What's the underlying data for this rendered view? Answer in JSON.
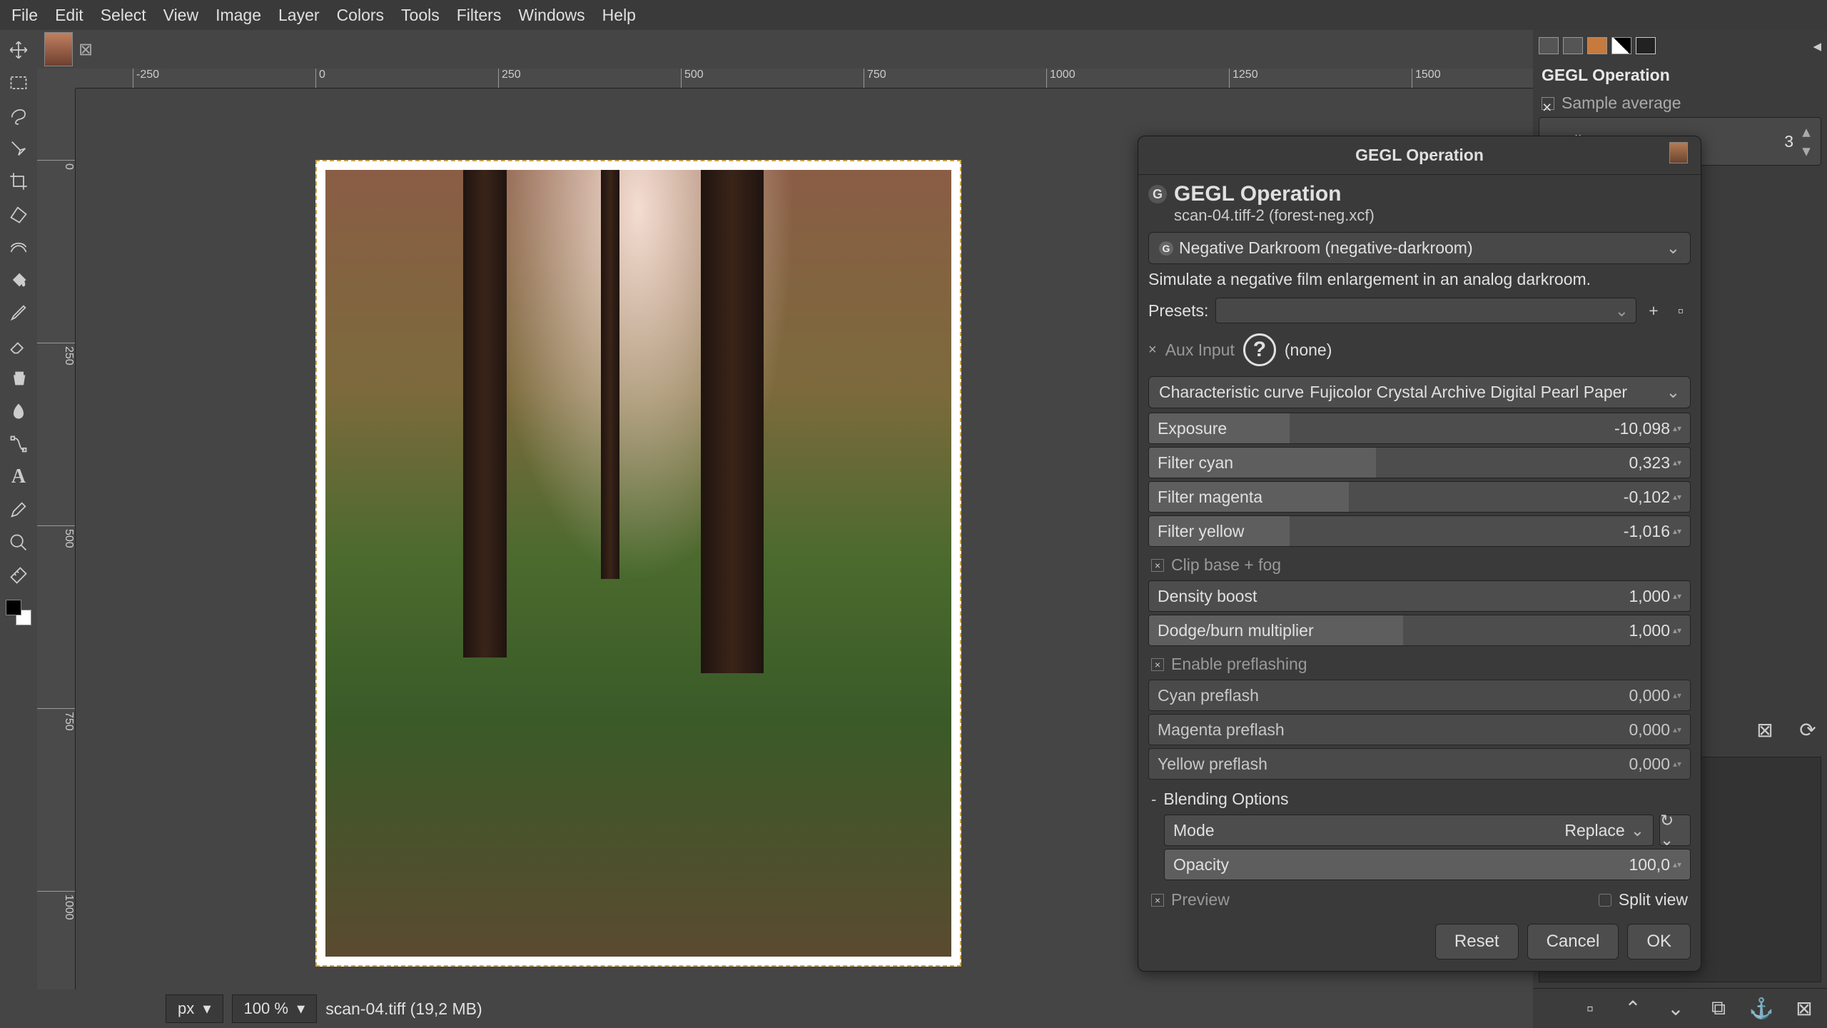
{
  "menu": {
    "items": [
      "File",
      "Edit",
      "Select",
      "View",
      "Image",
      "Layer",
      "Colors",
      "Tools",
      "Filters",
      "Windows",
      "Help"
    ]
  },
  "ruler_h": [
    "-250",
    "0",
    "250",
    "500",
    "750",
    "1000",
    "1250",
    "1500"
  ],
  "ruler_v": [
    "0",
    "250",
    "500",
    "750",
    "1000"
  ],
  "status": {
    "unit": "px",
    "zoom": "100 %",
    "file": "scan-04.tiff (19,2 MB)"
  },
  "right_panel": {
    "title": "GEGL Operation",
    "sample_average": "Sample average",
    "radius_label": "Radius",
    "radius_value": "3"
  },
  "dialog": {
    "title": "GEGL Operation",
    "header": "GEGL Operation",
    "subtitle": "scan-04.tiff-2 (forest-neg.xcf)",
    "operation": "Negative Darkroom (negative-darkroom)",
    "description": "Simulate a negative film enlargement in an analog darkroom.",
    "presets_label": "Presets:",
    "aux_label": "Aux Input",
    "aux_value": "(none)",
    "curve_label": "Characteristic curve",
    "curve_value": "Fujicolor Crystal Archive Digital Pearl Paper",
    "params": {
      "exposure": {
        "label": "Exposure",
        "value": "-10,098",
        "fill": 26
      },
      "filter_cyan": {
        "label": "Filter cyan",
        "value": "0,323",
        "fill": 42
      },
      "filter_magenta": {
        "label": "Filter magenta",
        "value": "-0,102",
        "fill": 37
      },
      "filter_yellow": {
        "label": "Filter yellow",
        "value": "-1,016",
        "fill": 26
      },
      "clip_base": "Clip base + fog",
      "density_boost": {
        "label": "Density boost",
        "value": "1,000",
        "fill": 0
      },
      "dodge_burn": {
        "label": "Dodge/burn multiplier",
        "value": "1,000",
        "fill": 47
      },
      "enable_preflash": "Enable preflashing",
      "cyan_preflash": {
        "label": "Cyan preflash",
        "value": "0,000",
        "fill": 0
      },
      "magenta_preflash": {
        "label": "Magenta preflash",
        "value": "0,000",
        "fill": 0
      },
      "yellow_preflash": {
        "label": "Yellow preflash",
        "value": "0,000",
        "fill": 0
      }
    },
    "blending_label": "Blending Options",
    "mode_label": "Mode",
    "mode_value": "Replace",
    "opacity": {
      "label": "Opacity",
      "value": "100,0",
      "fill": 100
    },
    "preview_label": "Preview",
    "split_label": "Split view",
    "buttons": {
      "reset": "Reset",
      "cancel": "Cancel",
      "ok": "OK"
    }
  }
}
